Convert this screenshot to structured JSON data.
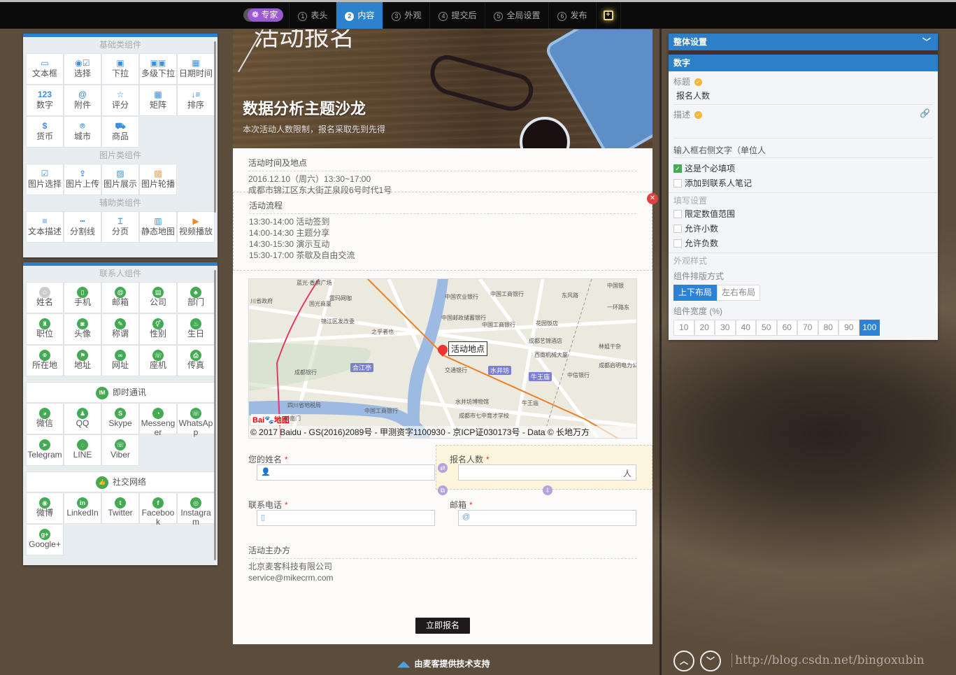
{
  "topbar": {
    "expert_label": "专家",
    "steps": [
      {
        "num": "1",
        "label": "表头"
      },
      {
        "num": "2",
        "label": "内容",
        "active": true
      },
      {
        "num": "3",
        "label": "外观"
      },
      {
        "num": "4",
        "label": "提交后"
      },
      {
        "num": "5",
        "label": "全局设置"
      },
      {
        "num": "6",
        "label": "发布"
      }
    ],
    "preview_icon": "preview-icon"
  },
  "left_panel": {
    "basic": {
      "title": "基础类组件",
      "items": [
        {
          "icon": "▭",
          "label": "文本框"
        },
        {
          "icon": "◉☑",
          "label": "选择"
        },
        {
          "icon": "▣",
          "label": "下拉"
        },
        {
          "icon": "▣▣",
          "label": "多级下拉"
        },
        {
          "icon": "▦",
          "label": "日期时间"
        },
        {
          "icon": "123",
          "label": "数字"
        },
        {
          "icon": "@",
          "label": "附件"
        },
        {
          "icon": "☆",
          "label": "评分"
        },
        {
          "icon": "▦",
          "label": "矩阵"
        },
        {
          "icon": "↓≡",
          "label": "排序"
        },
        {
          "icon": "$",
          "label": "货币"
        },
        {
          "icon": "⌾",
          "label": "城市"
        },
        {
          "icon": "⛟",
          "label": "商品"
        }
      ]
    },
    "image": {
      "title": "图片类组件",
      "items": [
        {
          "icon": "☑",
          "label": "图片选择"
        },
        {
          "icon": "⇪",
          "label": "图片上传"
        },
        {
          "icon": "▨",
          "label": "图片展示"
        },
        {
          "icon": "▨",
          "label": "图片轮播",
          "orange": true
        }
      ]
    },
    "aux": {
      "title": "辅助类组件",
      "items": [
        {
          "icon": "≡",
          "label": "文本描述"
        },
        {
          "icon": "┅",
          "label": "分割线"
        },
        {
          "icon": "⌶",
          "label": "分页"
        },
        {
          "icon": "▥",
          "label": "静态地图"
        },
        {
          "icon": "▶",
          "label": "视频播放",
          "orange": true
        }
      ]
    },
    "contact": {
      "title": "联系人组件",
      "items": [
        {
          "icon": "☺",
          "label": "姓名",
          "gray": true
        },
        {
          "icon": "▯",
          "label": "手机"
        },
        {
          "icon": "@",
          "label": "邮箱"
        },
        {
          "icon": "▤",
          "label": "公司"
        },
        {
          "icon": "♣",
          "label": "部门"
        },
        {
          "icon": "♜",
          "label": "职位"
        },
        {
          "icon": "◙",
          "label": "头像"
        },
        {
          "icon": "✎",
          "label": "称谓"
        },
        {
          "icon": "⚥",
          "label": "性别"
        },
        {
          "icon": "♨",
          "label": "生日"
        },
        {
          "icon": "⌾",
          "label": "所在地"
        },
        {
          "icon": "⚑",
          "label": "地址"
        },
        {
          "icon": "∞",
          "label": "网址"
        },
        {
          "icon": "☏",
          "label": "座机"
        },
        {
          "icon": "⎙",
          "label": "传真"
        }
      ]
    },
    "im": {
      "title": "即时通讯",
      "icon": "IM",
      "items": [
        {
          "icon": "◕",
          "label": "微信"
        },
        {
          "icon": "♟",
          "label": "QQ"
        },
        {
          "icon": "S",
          "label": "Skype"
        },
        {
          "icon": "◔",
          "label": "Messenger"
        },
        {
          "icon": "☏",
          "label": "WhatsApp"
        },
        {
          "icon": "➤",
          "label": "Telegram"
        },
        {
          "icon": "◌",
          "label": "LINE"
        },
        {
          "icon": "☏",
          "label": "Viber"
        }
      ]
    },
    "social": {
      "title": "社交网络",
      "icon": "👍",
      "items": [
        {
          "icon": "◉",
          "label": "微博"
        },
        {
          "icon": "in",
          "label": "LinkedIn"
        },
        {
          "icon": "t",
          "label": "Twitter"
        },
        {
          "icon": "f",
          "label": "Facebook"
        },
        {
          "icon": "◎",
          "label": "Instagram"
        },
        {
          "icon": "g+",
          "label": "Google+"
        }
      ]
    }
  },
  "form": {
    "hero": {
      "logo": "活动报名",
      "title": "数据分析主题沙龙",
      "subtitle": "本次活动人数限制，报名采取先到先得"
    },
    "time_place": {
      "heading": "活动时间及地点",
      "lines": [
        "2016.12.10（周六）13:30~17:00",
        "成都市锦江区东大街芷泉段6号时代1号"
      ]
    },
    "schedule": {
      "heading": "活动流程",
      "lines": [
        "13:30-14:00  活动签到",
        "14:00-14:30  主题分享",
        "14:30-15:30  演示互动",
        "15:30-17:00  茶歇及自由交流"
      ]
    },
    "map": {
      "marker_label": "活动地点",
      "copyright": "© 2017 Baidu - GS(2016)2089号 - 甲测资字1100930 - 京ICP证030173号 - Data © 长地万方",
      "logo": "Bai地图",
      "labels": [
        "蓝光·香槟广场",
        "川省政府",
        "国光商厦",
        "雷玛网咖",
        "中国农业银行",
        "中国工商银行",
        "东风路",
        "中国银",
        "一环路东",
        "中国邮政储蓄银行",
        "中国工商银行",
        "锦江区发改委",
        "之乎者也",
        "花园饭店",
        "成都艺锦酒店",
        "林姐干杂",
        "西南机械大厦",
        "成都银行",
        "交通银行",
        "成都启明电力公司",
        "中信银行",
        "水井坊博物馆",
        "四川省地税局",
        "中国工商银行",
        "牛王庙",
        "成都市七中育才学校",
        "新南门"
      ],
      "stations": [
        "合江亭",
        "水井坊",
        "牛王庙"
      ]
    },
    "fields": {
      "name": {
        "label": "您的姓名",
        "required": "*"
      },
      "count": {
        "label": "报名人数",
        "required": "*",
        "suffix": "人"
      },
      "phone": {
        "label": "联系电话",
        "required": "*"
      },
      "email": {
        "label": "邮箱",
        "required": "*"
      }
    },
    "organizer": {
      "heading": "活动主办方",
      "lines": [
        "北京麦客科技有限公司",
        "service@mikecrm.com"
      ]
    },
    "submit_label": "立即报名"
  },
  "footer": {
    "powered": "由麦客提供技术支持",
    "watermark": "http://blog.csdn.net/bingoxubin"
  },
  "right_panel": {
    "global_title": "整体设置",
    "component_title": "数字",
    "title_label": "标题",
    "title_value": "报名人数",
    "desc_label": "描述",
    "desc_value": "",
    "suffix_label": "输入框右侧文字（单位人",
    "required_label": "这是个必填项",
    "required_checked": true,
    "notes_label": "添加到联系人笔记",
    "notes_checked": false,
    "fill_section": "填写设置",
    "fill_options": [
      {
        "label": "限定数值范围",
        "checked": false
      },
      {
        "label": "允许小数",
        "checked": false
      },
      {
        "label": "允许负数",
        "checked": false
      }
    ],
    "appearance_section": "外观样式",
    "layout_label": "组件排版方式",
    "layout_options": [
      "上下布局",
      "左右布局"
    ],
    "layout_selected": "上下布局",
    "width_label": "组件宽度 (%)",
    "width_options": [
      "10",
      "20",
      "30",
      "40",
      "50",
      "60",
      "70",
      "80",
      "90",
      "100"
    ],
    "width_selected": "100"
  },
  "colors": {
    "accent": "#2d7fc8",
    "green": "#44ab54",
    "expert": "#9b59d0",
    "required": "#e33333"
  }
}
